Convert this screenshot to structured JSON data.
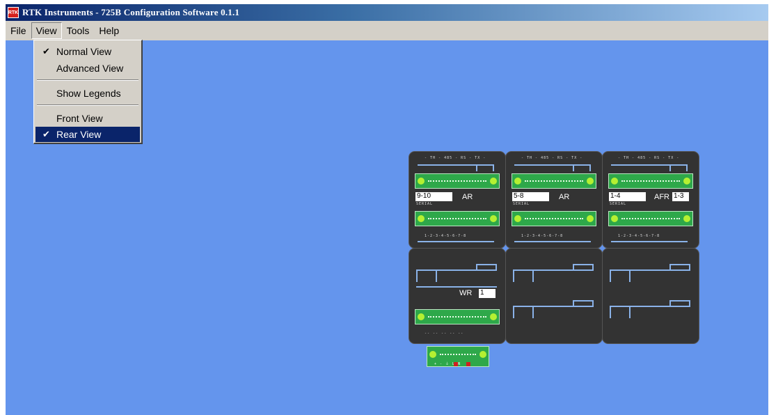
{
  "window": {
    "title": "RTK Instruments - 725B Configuration Software 0.1.1",
    "icon_text": "RTK",
    "background_color": "#6495ED"
  },
  "menubar": {
    "items": [
      "File",
      "View",
      "Tools",
      "Help"
    ],
    "open_menu": "View"
  },
  "view_menu": {
    "items": [
      {
        "label": "Normal View",
        "checked": true,
        "highlighted": false
      },
      {
        "label": "Advanced View",
        "checked": false,
        "highlighted": false
      },
      {
        "label": "Show Legends",
        "checked": false,
        "highlighted": false
      },
      {
        "label": "Front View",
        "checked": false,
        "highlighted": false
      },
      {
        "label": "Rear View",
        "checked": true,
        "highlighted": true
      }
    ],
    "check_glyph": "✔"
  },
  "panel": {
    "modules_top": [
      {
        "range_label": "9-10",
        "type_label": "AR",
        "extra_label": ""
      },
      {
        "range_label": "5-8",
        "type_label": "AR",
        "extra_label": ""
      },
      {
        "range_label": "1-4",
        "type_label": "AFR",
        "extra_label": "1-3"
      }
    ],
    "wr_module": {
      "type_label": "WR",
      "value_label": "1"
    },
    "connector_color": "#2EA84A",
    "module_color": "#333333"
  }
}
